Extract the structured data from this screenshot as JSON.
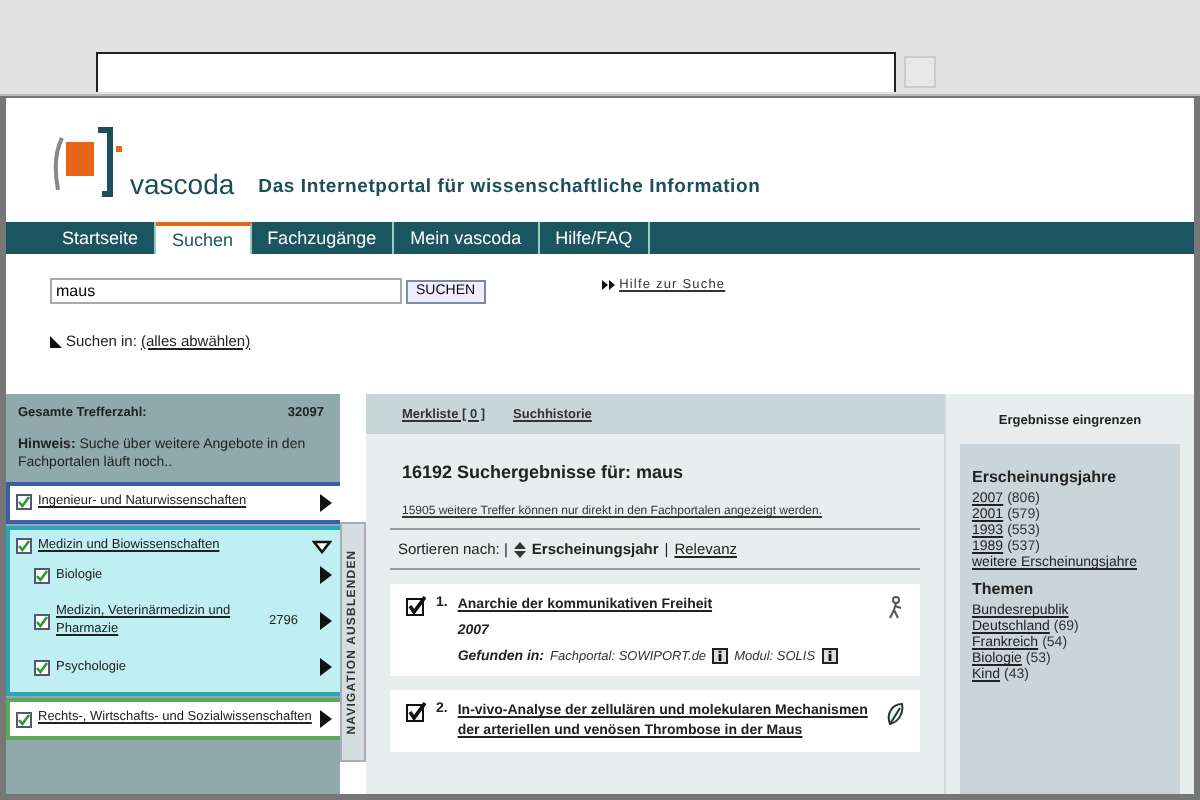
{
  "header": {
    "logo_text": "vascoda",
    "tagline": "Das Internetportal für wissenschaftliche Information"
  },
  "nav": [
    {
      "label": "Startseite",
      "selected": false
    },
    {
      "label": "Suchen",
      "selected": true
    },
    {
      "label": "Fachzugänge",
      "selected": false
    },
    {
      "label": "Mein vascoda",
      "selected": false
    },
    {
      "label": "Hilfe/FAQ",
      "selected": false
    }
  ],
  "search": {
    "value": "maus",
    "button": "SUCHEN",
    "help_link": "Hilfe zur Suche",
    "scope_label": "Suchen in:",
    "scope_link": "(alles abwählen)"
  },
  "sidebar": {
    "total_label": "Gesamte Trefferzahl:",
    "total_count": "32097",
    "hint": "**Hinweis:** Suche über weitere Angebote in den Fachportalen läuft noch..",
    "toggle_tab": "NAVIGATION AUSBLENDEN",
    "categories": [
      {
        "label": "Ingenieur- und Naturwissenschaften",
        "checked": true,
        "expanded": false,
        "color": "#3a5fa8"
      },
      {
        "label": "Medizin und Biowissenschaften",
        "checked": true,
        "expanded": true,
        "color": "#2aa7b5",
        "children": [
          {
            "label": "Biologie",
            "checked": true
          },
          {
            "label": "Medizin, Veterinärmedizin und Pharmazie",
            "checked": true,
            "count": "2796"
          },
          {
            "label": "Psychologie",
            "checked": true
          }
        ]
      },
      {
        "label": "Rechts-, Wirtschafts- und Sozialwissenschaften",
        "checked": true,
        "expanded": false,
        "color": "#5aa85a"
      }
    ]
  },
  "main": {
    "links": [
      "Merkliste [ 0 ]",
      "Suchhistorie"
    ],
    "heading": "16192 Suchergebnisse für: maus",
    "more_hits": "15905 weitere Treffer können nur direkt in den Fachportalen angezeigt werden.",
    "sort": {
      "label": "Sortieren nach: |",
      "separator": "|",
      "options": [
        {
          "label": "Erscheinungsjahr",
          "selected": true
        },
        {
          "label": "Relevanz",
          "selected": false
        }
      ]
    },
    "results": [
      {
        "number": "1.",
        "title": "Anarchie der kommunikativen Freiheit",
        "checked": true,
        "kind": "person",
        "year": "2007",
        "found_label": "Gefunden in:",
        "portal": "Fachportal: SOWIPORT.de",
        "module": "Modul: SOLIS"
      },
      {
        "number": "2.",
        "title": "In-vivo-Analyse der zellulären und molekularen Mechanismen der arteriellen und venösen Thrombose in der Maus",
        "checked": true,
        "kind": "leaf"
      }
    ]
  },
  "facets": {
    "title": "Ergebnisse eingrenzen",
    "groups": [
      {
        "title": "Erscheinungsjahre",
        "items": [
          {
            "label": "2007",
            "count": "(806)"
          },
          {
            "label": "2001",
            "count": "(579)"
          },
          {
            "label": "1993",
            "count": "(553)"
          },
          {
            "label": "1989",
            "count": "(537)"
          }
        ],
        "more": "weitere Erscheinungsjahre"
      },
      {
        "title": "Themen",
        "items": [
          {
            "label": "Bundesrepublik"
          },
          {
            "label": "Deutschland",
            "count": "(69)"
          },
          {
            "label": "Frankreich",
            "count": "(54)"
          },
          {
            "label": "Biologie",
            "count": "(53)"
          },
          {
            "label": "Kind",
            "count": "(43)"
          }
        ]
      }
    ]
  }
}
